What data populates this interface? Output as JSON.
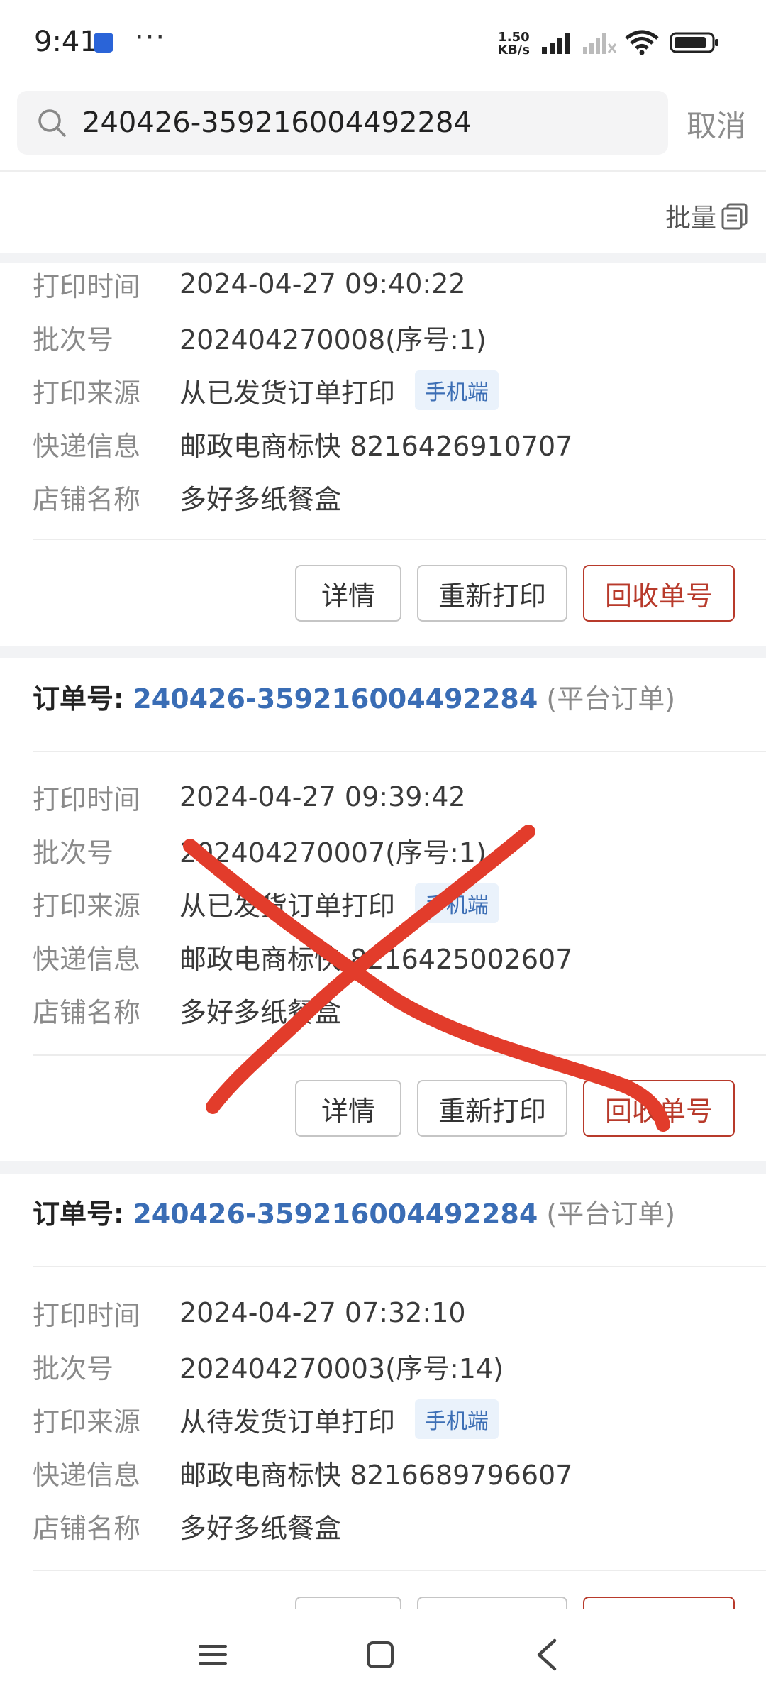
{
  "status_bar": {
    "time": "9:41",
    "dots": "···",
    "speed_value": "1.50",
    "speed_unit": "KB/s"
  },
  "search": {
    "query": "240426-359216004492284",
    "cancel": "取消"
  },
  "toolbar": {
    "batch_label": "批量"
  },
  "labels": {
    "print_time": "打印时间",
    "batch_no": "批次号",
    "print_source": "打印来源",
    "express_info": "快递信息",
    "shop_name": "店铺名称",
    "order_label": "订单号:",
    "detail": "详情",
    "reprint": "重新打印",
    "recycle": "回收单号"
  },
  "orders": [
    {
      "print_time": "2024-04-27 09:40:22",
      "batch_no": "202404270008(序号:1)",
      "print_source": "从已发货订单打印",
      "source_tag": "手机端",
      "express_info": "邮政电商标快 8216426910707",
      "shop_name": "多好多纸餐盒"
    },
    {
      "order_no": "240426-359216004492284",
      "order_type": "(平台订单)",
      "print_time": "2024-04-27 09:39:42",
      "batch_no": "202404270007(序号:1)",
      "print_source": "从已发货订单打印",
      "source_tag": "手机端",
      "express_info": "邮政电商标快 8216425002607",
      "shop_name": "多好多纸餐盒"
    },
    {
      "order_no": "240426-359216004492284",
      "order_type": "(平台订单)",
      "print_time": "2024-04-27 07:32:10",
      "batch_no": "202404270003(序号:14)",
      "print_source": "从待发货订单打印",
      "source_tag": "手机端",
      "express_info": "邮政电商标快 8216689796607",
      "shop_name": "多好多纸餐盒"
    }
  ],
  "colors": {
    "accent_blue": "#3a6db5",
    "recycle_red": "#b83a2b",
    "mark_red": "#e23c2b"
  }
}
